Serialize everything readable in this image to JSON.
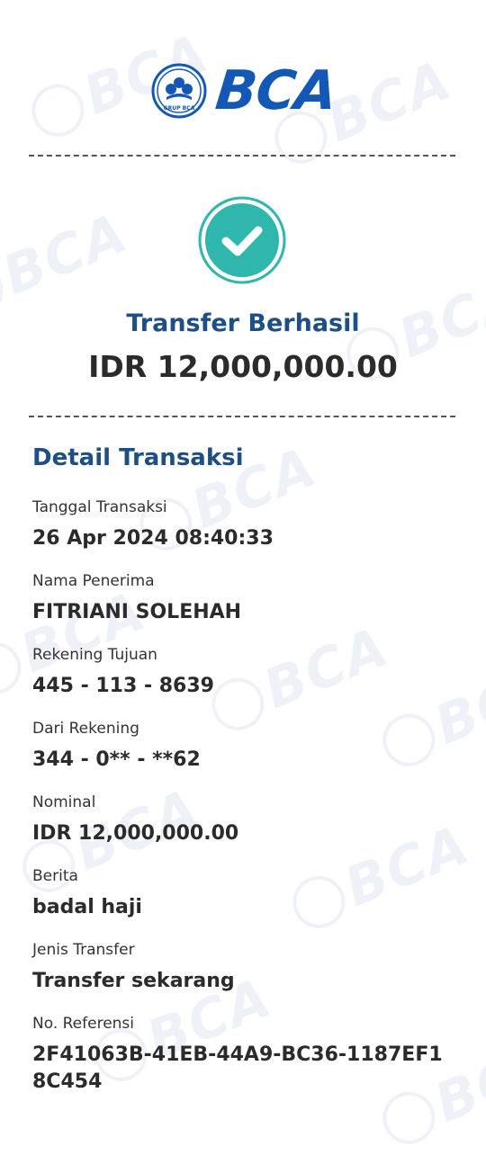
{
  "header": {
    "brand_name": "BCA",
    "emblem_caption": "GRUP BCA"
  },
  "status": {
    "title": "Transfer Berhasil",
    "amount": "IDR 12,000,000.00",
    "icon": "check-circle-icon"
  },
  "detail": {
    "section_title": "Detail Transaksi",
    "fields": [
      {
        "label": "Tanggal Transaksi",
        "value": "26 Apr 2024 08:40:33"
      },
      {
        "label": "Nama Penerima",
        "value": "FITRIANI SOLEHAH"
      },
      {
        "label": "Rekening Tujuan",
        "value": "445 - 113 - 8639"
      },
      {
        "label": "Dari Rekening",
        "value": "344 - 0** - **62"
      },
      {
        "label": "Nominal",
        "value": "IDR 12,000,000.00"
      },
      {
        "label": "Berita",
        "value": "badal haji"
      },
      {
        "label": "Jenis Transfer",
        "value": "Transfer sekarang"
      },
      {
        "label": "No. Referensi",
        "value": "2F41063B-41EB-44A9-BC36-1187EF18C454"
      }
    ]
  },
  "colors": {
    "brand_blue": "#1458b5",
    "title_blue": "#1d4f86",
    "success_teal": "#2fb6ad"
  }
}
